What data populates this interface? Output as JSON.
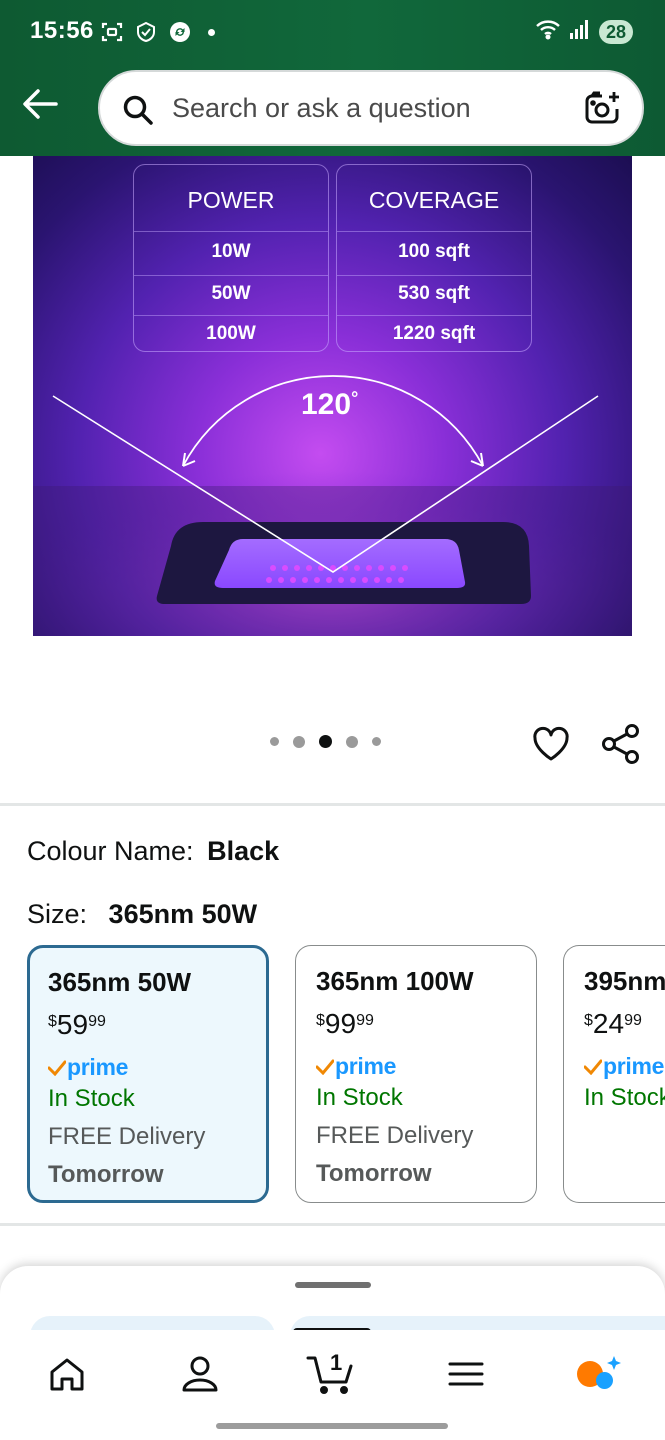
{
  "status_bar": {
    "time": "15:56",
    "battery": "28"
  },
  "search": {
    "placeholder": "Search or ask a question"
  },
  "product_image": {
    "spec_headers": [
      "POWER",
      "COVERAGE"
    ],
    "spec_rows": [
      [
        "10W",
        "100 sqft"
      ],
      [
        "50W",
        "530 sqft"
      ],
      [
        "100W",
        "1220 sqft"
      ]
    ],
    "angle": "120",
    "angle_unit": "°"
  },
  "carousel": {
    "total": 5,
    "active_index": 2
  },
  "colour": {
    "label": "Colour Name:",
    "value": "Black"
  },
  "size": {
    "label": "Size:",
    "value": "365nm 50W"
  },
  "size_options": [
    {
      "title": "365nm 50W",
      "price_symbol": "$",
      "price_whole": "59",
      "price_fraction": "99",
      "prime": "prime",
      "stock": "In Stock",
      "delivery": "FREE Delivery",
      "delivery_day": "Tomorrow",
      "selected": true
    },
    {
      "title": "365nm 100W",
      "price_symbol": "$",
      "price_whole": "99",
      "price_fraction": "99",
      "prime": "prime",
      "stock": "In Stock",
      "delivery": "FREE Delivery",
      "delivery_day": "Tomorrow",
      "selected": false
    },
    {
      "title": "395nm",
      "price_symbol": "$",
      "price_whole": "24",
      "price_fraction": "99",
      "prime": "prime",
      "stock": "In Stock",
      "delivery": "",
      "delivery_day": "",
      "selected": false
    }
  ],
  "bottom_nav": {
    "cart_count": "1",
    "items": [
      "home-icon",
      "account-icon",
      "cart-icon",
      "menu-icon",
      "rufus-icon"
    ]
  },
  "colors": {
    "header_green": "#11683b",
    "prime_blue": "#1a98ff",
    "in_stock_green": "#007600",
    "selected_border": "#2c6a91",
    "selected_bg": "#edf8fd"
  }
}
